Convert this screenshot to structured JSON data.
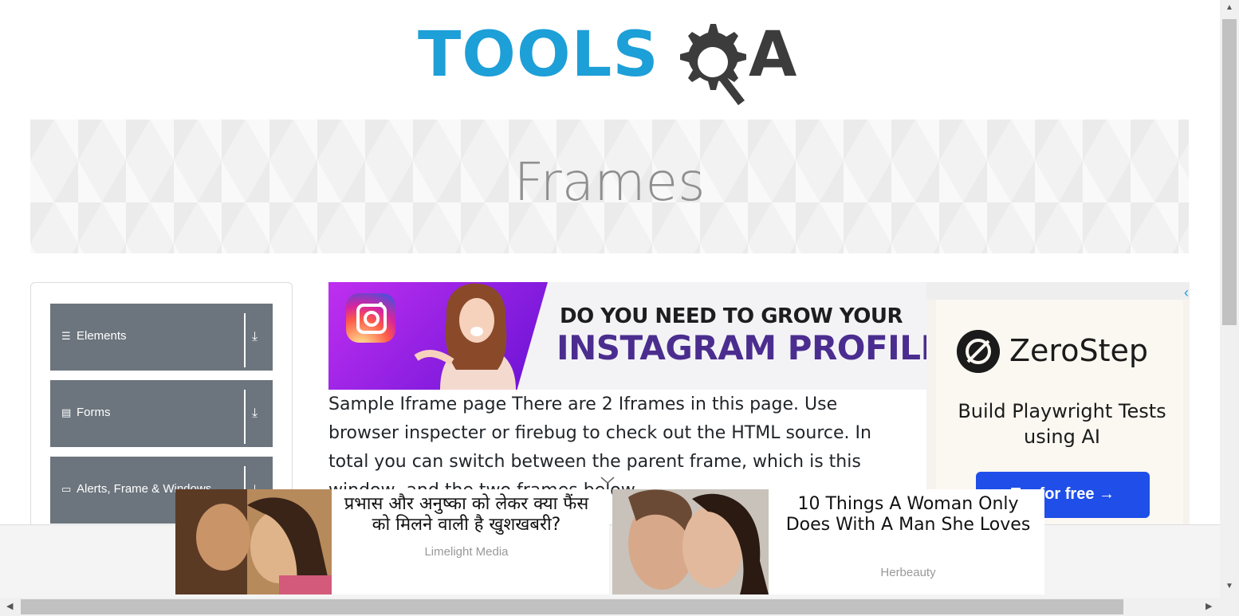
{
  "header": {
    "logo_left": "TOOLS",
    "logo_right": "A",
    "logo_alt": "TOOLSQA"
  },
  "banner": {
    "title": "Frames"
  },
  "sidebar": {
    "groups": [
      {
        "label": "Elements",
        "icon": "menu-icon"
      },
      {
        "label": "Forms",
        "icon": "form-icon"
      },
      {
        "label": "Alerts, Frame & Windows",
        "icon": "window-icon"
      }
    ]
  },
  "ads": {
    "instagram": {
      "line1": "DO YOU NEED TO GROW YOUR",
      "line2": "INSTAGRAM PROFILE?"
    },
    "zerostep": {
      "brand": "ZeroStep",
      "tagline": "Build Playwright Tests using AI",
      "cta": "Try for free →"
    },
    "sticky": [
      {
        "title": "प्रभास और अनुष्का को लेकर क्या फैंस को मिलने वाली है खुशखबरी?",
        "source": "Limelight Media"
      },
      {
        "title": "10 Things A Woman Only Does With A Man She Loves",
        "source": "Herbeauty"
      }
    ]
  },
  "content": {
    "text": "Sample Iframe page There are 2 Iframes in this page. Use browser inspecter or firebug to check out the HTML source. In total you can switch between the parent frame, which is this window, and the two frames below"
  },
  "colors": {
    "brand_blue": "#1d9fd8",
    "sidebar_grey": "#6c757d",
    "cta_blue": "#1f4ee8"
  }
}
